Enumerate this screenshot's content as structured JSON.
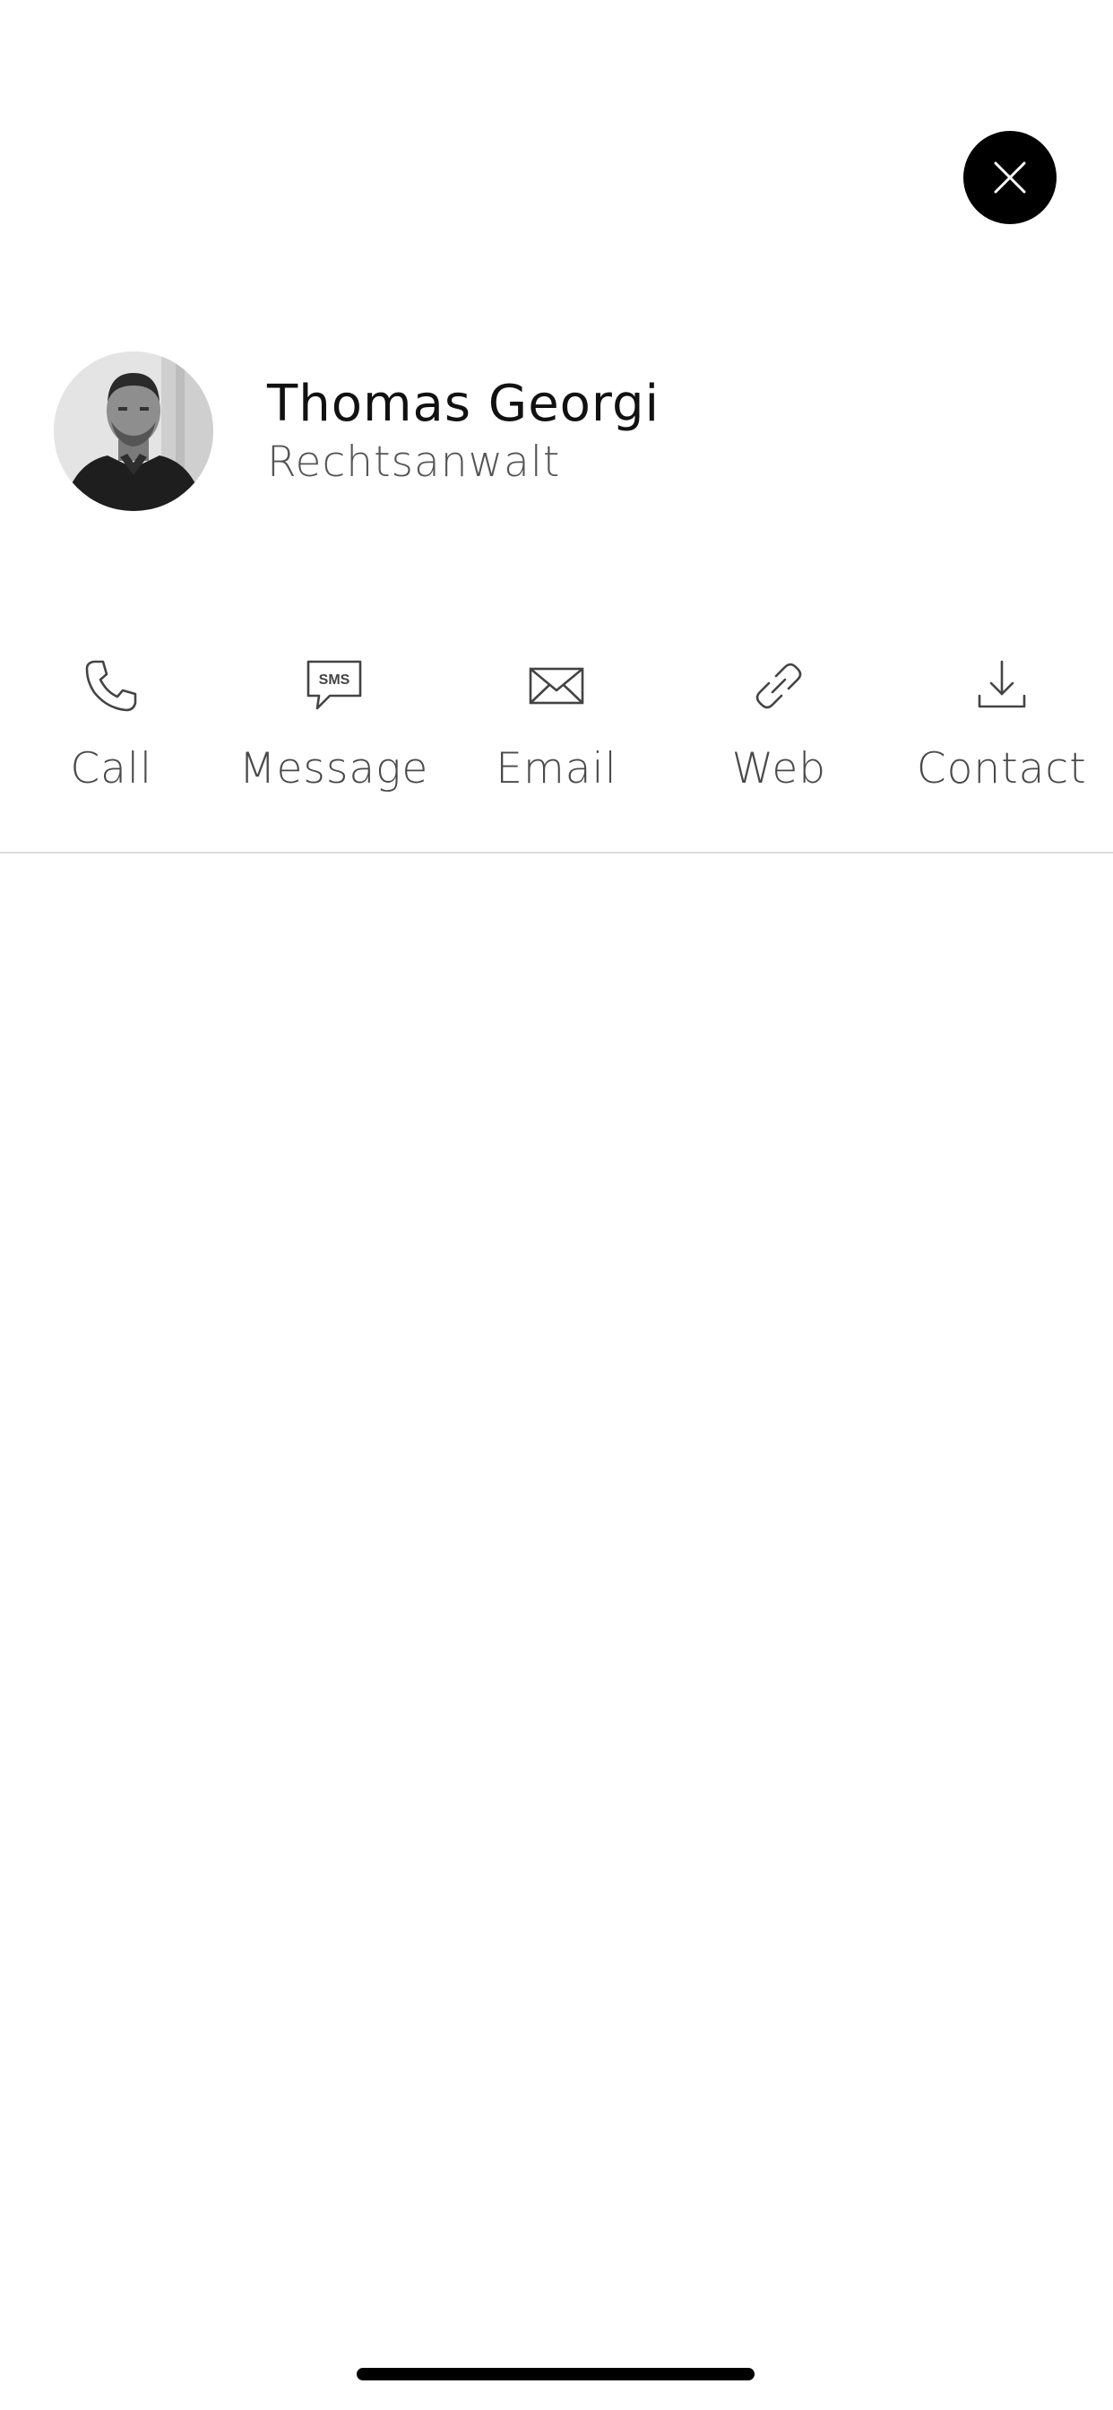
{
  "close": {
    "icon": "close-icon"
  },
  "profile": {
    "name": "Thomas Georgi",
    "title": "Rechtsanwalt",
    "avatar_icon": "avatar"
  },
  "actions": [
    {
      "label": "Call",
      "icon": "phone-icon"
    },
    {
      "label": "Message",
      "icon": "sms-icon",
      "icon_text": "SMS"
    },
    {
      "label": "Email",
      "icon": "envelope-icon"
    },
    {
      "label": "Web",
      "icon": "link-icon"
    },
    {
      "label": "Contact",
      "icon": "download-icon"
    }
  ],
  "colors": {
    "background": "#ffffff",
    "close_button": "#000000",
    "label_text": "#4a4a4a",
    "divider": "#dcdcdc"
  }
}
